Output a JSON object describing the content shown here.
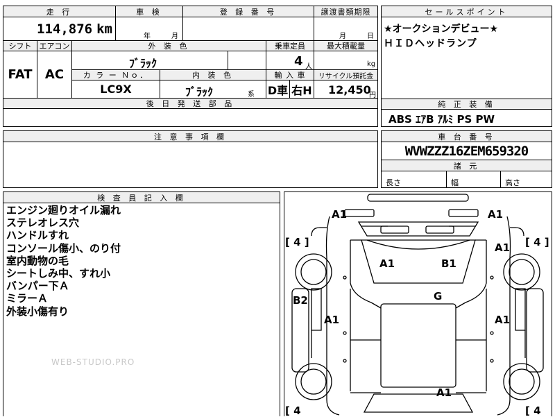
{
  "top": {
    "mileage_label": "走 行",
    "mileage_value": "114,876",
    "mileage_unit": "km",
    "inspection_label": "車 検",
    "inspection_year": "年",
    "inspection_month": "月",
    "registration_label": "登 録 番 号",
    "transfer_label": "譲渡書類期限",
    "transfer_month": "月",
    "transfer_day": "日",
    "shift_label": "シフト",
    "shift_value": "FAT",
    "aircon_label": "エアコン",
    "aircon_value": "AC",
    "exterior_label": "外 装 色",
    "exterior_value": "ﾌﾞﾗｯｸ",
    "capacity_label": "乗車定員",
    "capacity_value": "4",
    "capacity_unit": "人",
    "loadcap_label": "最大積載量",
    "loadcap_unit": "kg",
    "colorno_label": "カ ラ ー Ｎｏ．",
    "colorno_value": "LC9X",
    "interior_label": "内 装 色",
    "interior_value": "ﾌﾞﾗｯｸ",
    "interior_suffix": "系",
    "import_label": "輸 入 車",
    "import_value_1": "D車",
    "import_value_2": "右H",
    "recycle_label": "リサイクル預託金",
    "recycle_value": "12,450",
    "recycle_unit": "円",
    "parts_label": "後 日 発 送 部 品"
  },
  "selling_points": {
    "label": "セールスポイント",
    "line1": "★オークションデビュー★",
    "line2": "ＨＩＤヘッドランプ"
  },
  "equipment": {
    "label": "純 正 装 備",
    "value": "ABS ｴｱB ｱﾙﾐ PS PW"
  },
  "notes": {
    "label": "注 意 事 項 欄"
  },
  "chassis": {
    "label": "車 台 番 号",
    "value": "WVWZZZ16ZEM659320",
    "dims_label": "諸 元",
    "length_label": "長さ",
    "width_label": "幅",
    "height_label": "高さ"
  },
  "inspector": {
    "label": "検 査 員 記 入 欄",
    "lines": [
      "エンジン廻りオイル漏れ",
      "ステレオレス穴",
      "ハンドルすれ",
      "コンソール傷小、のり付",
      "室内動物の毛",
      "シートしみ中、すれ小",
      "バンパー下Ａ",
      "ミラーＡ",
      "外装小傷有り"
    ],
    "watermark": "WEB-STUDIO.PRO"
  },
  "diagram": {
    "marks": [
      "A1",
      "A1",
      "A1",
      "B1",
      "A1",
      "G",
      "B2",
      "A1",
      "A1",
      "A1"
    ],
    "tires": [
      "[ 4 ]",
      "[ 4 ]",
      "[ 4",
      "[ 4"
    ]
  }
}
